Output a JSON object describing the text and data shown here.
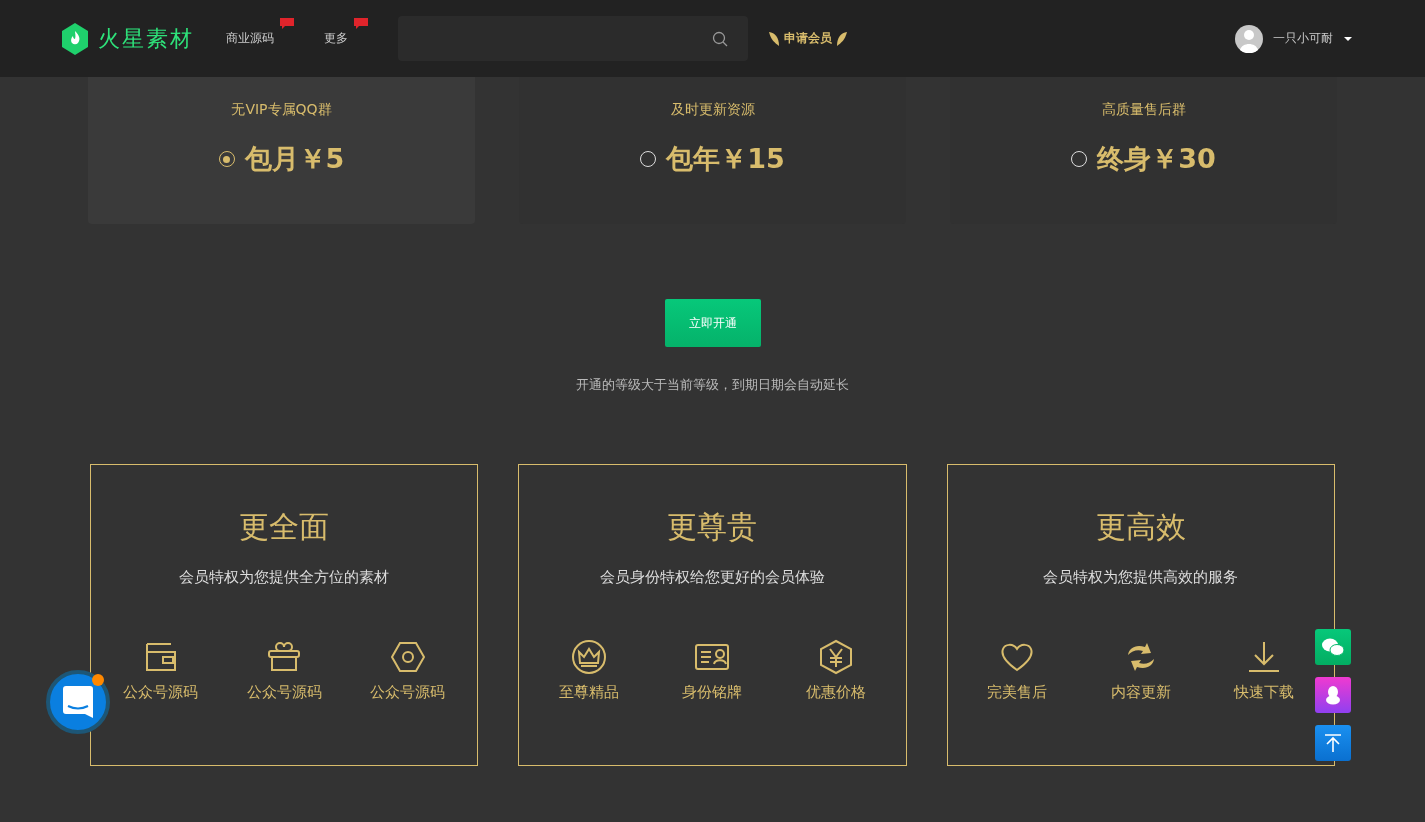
{
  "header": {
    "logo": "火星素材",
    "nav": [
      {
        "label": "商业源码",
        "badge": true
      },
      {
        "label": "更多",
        "badge": true
      }
    ],
    "apply": "申请会员",
    "user": "一只小可耐"
  },
  "plans": [
    {
      "feature": "无VIP专属QQ群",
      "price": "包月￥5",
      "selected": true
    },
    {
      "feature": "及时更新资源",
      "price": "包年￥15",
      "selected": false
    },
    {
      "feature": "高质量售后群",
      "price": "终身￥30",
      "selected": false
    }
  ],
  "open_button": "立即开通",
  "note": "开通的等级大于当前等级，到期日期会自动延长",
  "benefits": [
    {
      "title": "更全面",
      "subtitle": "会员特权为您提供全方位的素材",
      "items": [
        {
          "label": "公众号源码"
        },
        {
          "label": "公众号源码"
        },
        {
          "label": "公众号源码"
        }
      ]
    },
    {
      "title": "更尊贵",
      "subtitle": "会员身份特权给您更好的会员体验",
      "items": [
        {
          "label": "至尊精品"
        },
        {
          "label": "身份铭牌"
        },
        {
          "label": "优惠价格"
        }
      ]
    },
    {
      "title": "更高效",
      "subtitle": "会员特权为您提供高效的服务",
      "items": [
        {
          "label": "完美售后"
        },
        {
          "label": "内容更新"
        },
        {
          "label": "快速下载"
        }
      ]
    }
  ],
  "side_buttons": [
    {
      "kind": "wechat"
    },
    {
      "kind": "qq"
    },
    {
      "kind": "top"
    }
  ]
}
